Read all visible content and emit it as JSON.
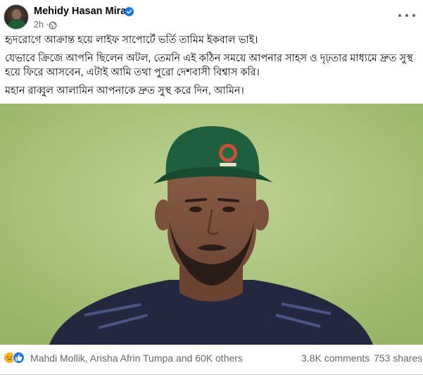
{
  "post": {
    "author": "Mehidy Hasan Miraz",
    "timestamp": "2h ·",
    "paragraphs": [
      "হৃদরোগে আক্রান্ত হয়ে লাইফ সাপোর্টে ভর্তি তামিম ইকবাল ভাই।",
      "যেভাবে ক্রিজে আপনি ছিলেন অটল, তেমনি এই কঠিন সময়ে আপনার সাহস ও দৃঢ়তার মাধ্যমে দ্রুত সুস্থ হয়ে ফিরে আসবেন, এটাই আমি তথা পুরো দেশবাসী বিশ্বাস করি।",
      "মহান রাব্বুল আলামিন আপনাকে দ্রুত সুস্থ করে দিন, আমিন।"
    ],
    "image_icon": "photo-cricketer-portrait",
    "reactions": {
      "icons": [
        "sad-reaction-icon",
        "like-reaction-icon"
      ],
      "text": "Mahdi Mollik, Arisha Afrin Tumpa and 60K others"
    },
    "comments": "3.8K comments",
    "shares": "753 shares"
  },
  "colors": {
    "text": "#050505",
    "secondary": "#65676b",
    "verified": "#1877f2",
    "cap": "#1f5f3d",
    "background": "#a7c07a"
  }
}
